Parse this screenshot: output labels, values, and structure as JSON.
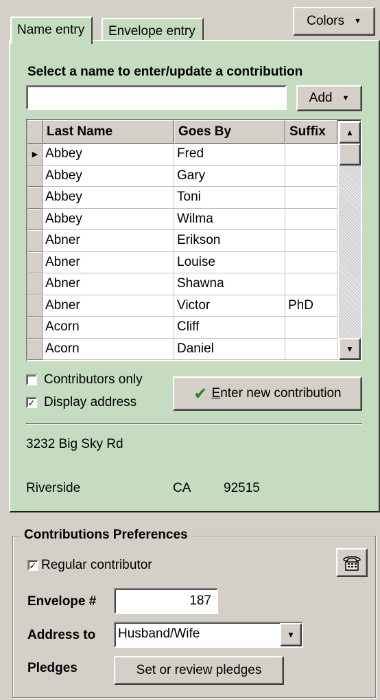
{
  "tabs": [
    {
      "label": "Name entry",
      "active": true
    },
    {
      "label": "Envelope entry",
      "active": false
    }
  ],
  "colors_button": "Colors",
  "select_prompt": "Select a name to enter/update a contribution",
  "search": {
    "value": "",
    "placeholder": ""
  },
  "add_button": "Add",
  "grid": {
    "columns": [
      "Last Name",
      "Goes By",
      "Suffix"
    ],
    "rows": [
      {
        "last": "Abbey",
        "goes_by": "Fred",
        "suffix": "",
        "current": true
      },
      {
        "last": "Abbey",
        "goes_by": "Gary",
        "suffix": ""
      },
      {
        "last": "Abbey",
        "goes_by": "Toni",
        "suffix": ""
      },
      {
        "last": "Abbey",
        "goes_by": "Wilma",
        "suffix": ""
      },
      {
        "last": "Abner",
        "goes_by": "Erikson",
        "suffix": ""
      },
      {
        "last": "Abner",
        "goes_by": "Louise",
        "suffix": ""
      },
      {
        "last": "Abner",
        "goes_by": "Shawna",
        "suffix": ""
      },
      {
        "last": "Abner",
        "goes_by": "Victor",
        "suffix": "PhD"
      },
      {
        "last": "Acorn",
        "goes_by": "Cliff",
        "suffix": ""
      },
      {
        "last": "Acorn",
        "goes_by": "Daniel",
        "suffix": ""
      }
    ]
  },
  "contributors_only": {
    "label": "Contributors only",
    "checked": false
  },
  "display_address": {
    "label": "Display address",
    "checked": true
  },
  "enter_button": {
    "accel": "E",
    "rest": "nter new contribution"
  },
  "address": {
    "street": "3232 Big Sky Rd",
    "city": "Riverside",
    "state": "CA",
    "zip": "92515"
  },
  "prefs": {
    "title": "Contributions Preferences",
    "regular": {
      "label": "Regular contributor",
      "checked": true
    },
    "envelope_label": "Envelope #",
    "envelope_value": "187",
    "address_to_label": "Address to",
    "address_to_value": "Husband/Wife",
    "pledges_label": "Pledges",
    "pledges_button": "Set or review pledges"
  },
  "colors": {
    "panel": "#c5dcc0",
    "window": "#d4d0c8",
    "check_green": "#1f8a1f"
  },
  "icons": {
    "dropdown": "triangle-down-icon",
    "phone": "telephone-icon"
  }
}
